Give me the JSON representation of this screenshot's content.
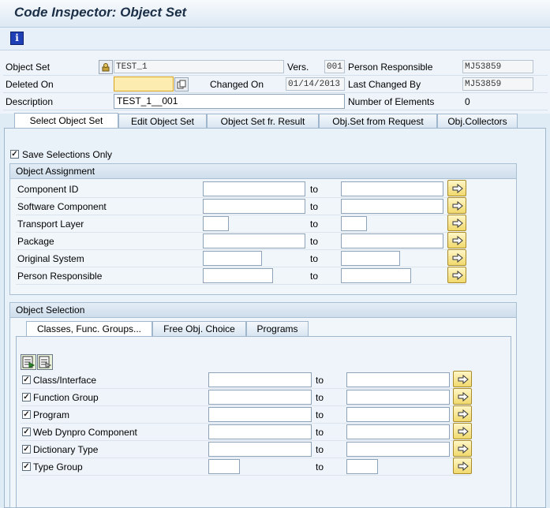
{
  "window": {
    "title": "Code Inspector: Object Set"
  },
  "toolbar": {
    "info_icon_label": "i"
  },
  "header": {
    "object_set_label": "Object Set",
    "object_set_value": "TEST_1",
    "vers_label": "Vers.",
    "vers_value": "001",
    "person_responsible_label": "Person Responsible",
    "person_responsible_value": "MJ53859",
    "deleted_on_label": "Deleted On",
    "deleted_on_value": "",
    "changed_on_label": "Changed On",
    "changed_on_value": "01/14/2013",
    "last_changed_by_label": "Last Changed By",
    "last_changed_by_value": "MJ53859",
    "description_label": "Description",
    "description_value": "TEST_1__001",
    "num_elements_label": "Number of Elements",
    "num_elements_value": "0"
  },
  "tabs": [
    {
      "label": "Select Object Set",
      "active": true
    },
    {
      "label": "Edit Object Set",
      "active": false
    },
    {
      "label": "Object Set fr. Result",
      "active": false
    },
    {
      "label": "Obj.Set from Request",
      "active": false
    },
    {
      "label": "Obj.Collectors",
      "active": false
    }
  ],
  "save_selections": {
    "label": "Save Selections Only",
    "checked": true
  },
  "object_assignment": {
    "title": "Object Assignment",
    "to_label": "to",
    "rows": [
      {
        "label": "Component ID",
        "from": "",
        "to": ""
      },
      {
        "label": "Software Component",
        "from": "",
        "to": ""
      },
      {
        "label": "Transport Layer",
        "from": "",
        "to": ""
      },
      {
        "label": "Package",
        "from": "",
        "to": ""
      },
      {
        "label": "Original System",
        "from": "",
        "to": ""
      },
      {
        "label": "Person Responsible",
        "from": "",
        "to": ""
      }
    ]
  },
  "object_selection": {
    "title": "Object Selection",
    "subtabs": [
      {
        "label": "Classes, Func. Groups...",
        "active": true
      },
      {
        "label": "Free Obj. Choice",
        "active": false
      },
      {
        "label": "Programs",
        "active": false
      }
    ],
    "to_label": "to",
    "rows": [
      {
        "label": "Class/Interface",
        "checked": true,
        "from": "",
        "to": ""
      },
      {
        "label": "Function Group",
        "checked": true,
        "from": "",
        "to": ""
      },
      {
        "label": "Program",
        "checked": true,
        "from": "",
        "to": ""
      },
      {
        "label": "Web Dynpro Component",
        "checked": true,
        "from": "",
        "to": ""
      },
      {
        "label": "Dictionary Type",
        "checked": true,
        "from": "",
        "to": ""
      },
      {
        "label": "Type Group",
        "checked": true,
        "from": "",
        "to": ""
      }
    ]
  },
  "checkmark": "✓",
  "colors": {
    "required_field": "#fdecb0",
    "arrow_button": "#f0d96d",
    "panel_bg": "#eaf2f9"
  }
}
